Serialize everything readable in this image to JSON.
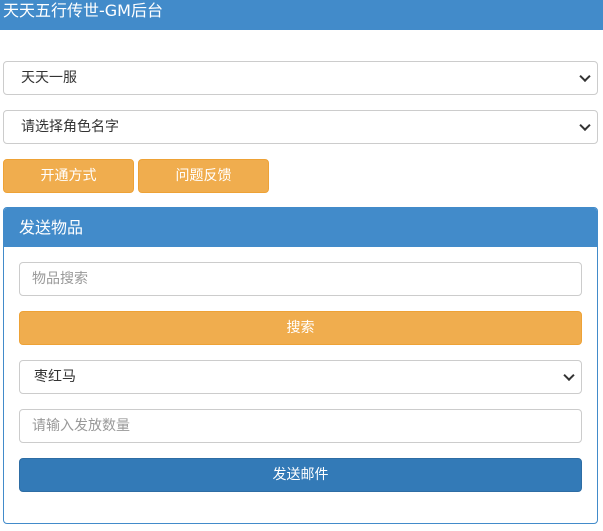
{
  "header": {
    "title": "天天五行传世-GM后台"
  },
  "server_select": {
    "value": "天天一服"
  },
  "role_select": {
    "value": "请选择角色名字"
  },
  "actions": {
    "open_label": "开通方式",
    "feedback_label": "问题反馈"
  },
  "send_panel": {
    "title": "发送物品",
    "search_placeholder": "物品搜索",
    "search_button": "搜索",
    "item_value": "枣红马",
    "quantity_placeholder": "请输入发放数量",
    "send_button": "发送邮件"
  },
  "colors": {
    "primary": "#428bca",
    "primary_button": "#337ab7",
    "warning": "#f0ad4e"
  }
}
